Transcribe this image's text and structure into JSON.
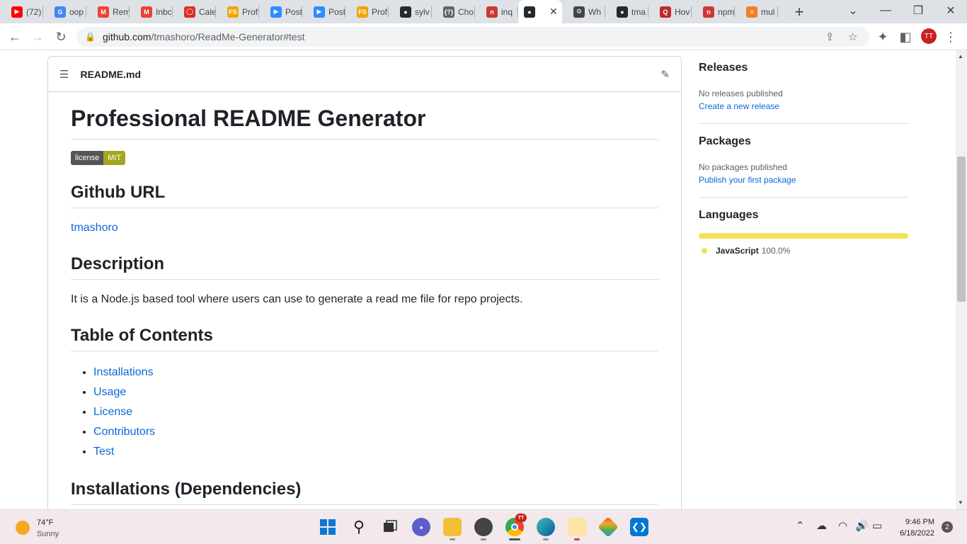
{
  "browser": {
    "tabs": [
      {
        "title": "(72)",
        "icon": "youtube-icon",
        "color": "#ff0000"
      },
      {
        "title": "oop",
        "icon": "google-icon",
        "color": "#4285f4"
      },
      {
        "title": "Rem",
        "icon": "gmail-icon",
        "color": "#ea4335"
      },
      {
        "title": "Inbc",
        "icon": "gmail-icon",
        "color": "#ea4335"
      },
      {
        "title": "Cale",
        "icon": "calendar-icon",
        "color": "#d93025"
      },
      {
        "title": "Prof",
        "icon": "fs-icon",
        "color": "#f4a300"
      },
      {
        "title": "Post",
        "icon": "zoom-icon",
        "color": "#2d8cff"
      },
      {
        "title": "Post",
        "icon": "zoom-icon",
        "color": "#2d8cff"
      },
      {
        "title": "Prof",
        "icon": "fs-icon",
        "color": "#f4a300"
      },
      {
        "title": "sylv",
        "icon": "github-icon",
        "color": "#24292f"
      },
      {
        "title": "Cho",
        "icon": "code-icon",
        "color": "#5f6368"
      },
      {
        "title": "inq",
        "icon": "npm-icon",
        "color": "#cb3837"
      },
      {
        "title": "",
        "icon": "github-icon",
        "color": "#24292f",
        "active": true
      },
      {
        "title": "Wh",
        "icon": "gear-icon",
        "color": "#444444"
      },
      {
        "title": "tma",
        "icon": "github-icon",
        "color": "#24292f"
      },
      {
        "title": "Hov",
        "icon": "quora-icon",
        "color": "#b92b27"
      },
      {
        "title": "npm",
        "icon": "npm-icon",
        "color": "#cb3837"
      },
      {
        "title": "mul",
        "icon": "stackoverflow-icon",
        "color": "#f48024"
      }
    ],
    "url_host": "github.com",
    "url_path": "/tmashoro/ReadMe-Generator#test",
    "profile_initials": "TT"
  },
  "readme": {
    "filename": "README.md",
    "title": "Professional README Generator",
    "badge": {
      "left": "license",
      "right": "MIT",
      "left_color": "#555555",
      "right_color": "#a4a61d"
    },
    "github_heading": "Github URL",
    "github_link": "tmashoro",
    "description_heading": "Description",
    "description_text": "It is a Node.js based tool where users can use to generate a read me file for repo projects.",
    "toc_heading": "Table of Contents",
    "toc": [
      "Installations",
      "Usage",
      "License",
      "Contributors",
      "Test"
    ],
    "install_heading": "Installations (Dependencies)"
  },
  "sidebar": {
    "releases": {
      "heading": "Releases",
      "muted": "No releases published",
      "link": "Create a new release"
    },
    "packages": {
      "heading": "Packages",
      "muted": "No packages published",
      "link": "Publish your first package"
    },
    "languages": {
      "heading": "Languages",
      "name": "JavaScript",
      "percent": "100.0%",
      "share": 1.0,
      "color": "#f1e05a"
    }
  },
  "taskbar": {
    "weather_temp": "74°F",
    "weather_text": "Sunny",
    "time": "9:46 PM",
    "date": "6/18/2022",
    "notification_count": "2",
    "chrome_badge": "TT"
  }
}
